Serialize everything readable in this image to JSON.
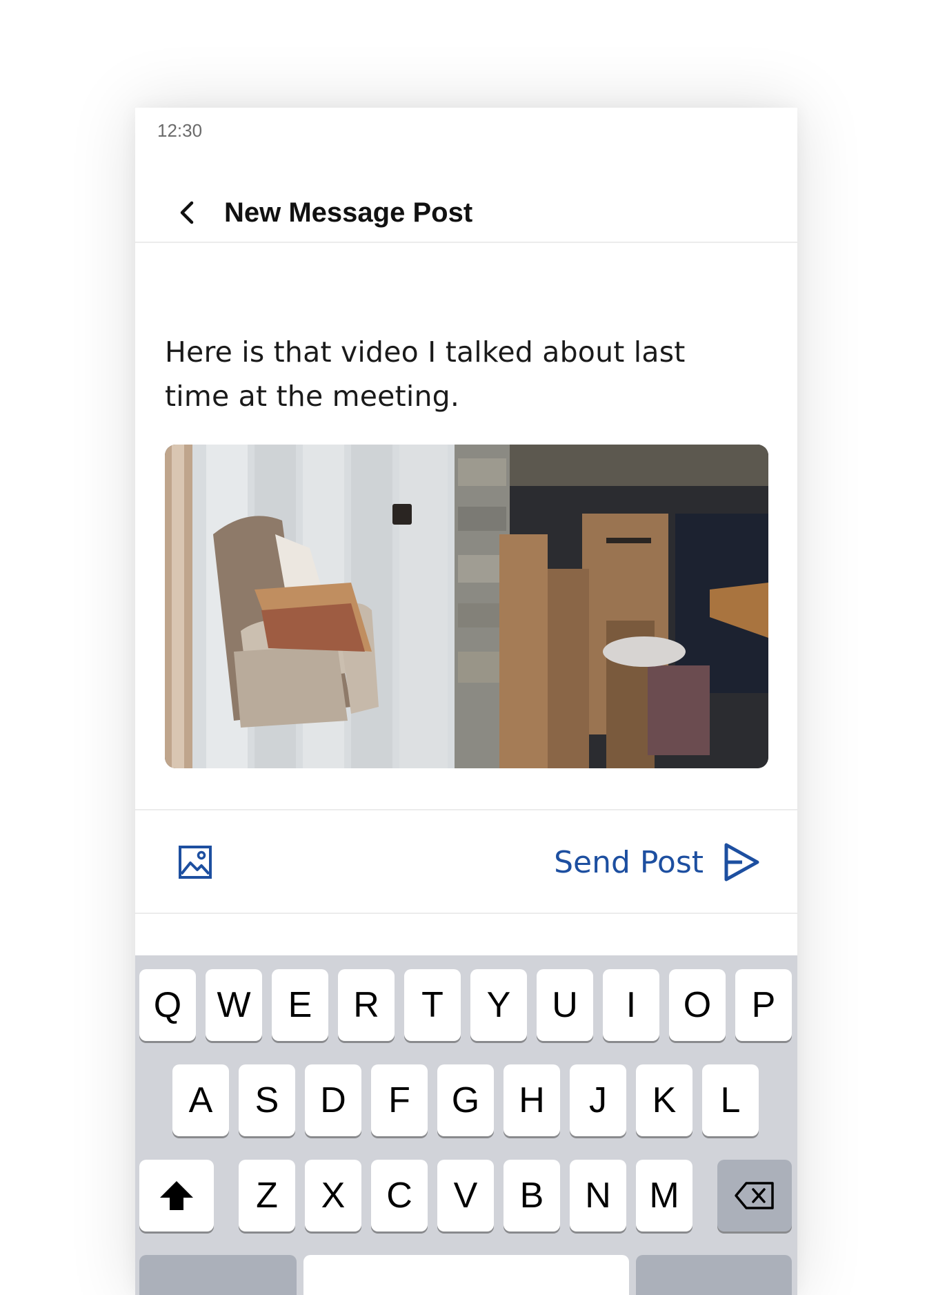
{
  "status_bar": {
    "time": "12:30"
  },
  "header": {
    "title": "New Message Post"
  },
  "message": {
    "text": "Here is that video I talked about last time at the meeting."
  },
  "actions": {
    "send_label": "Send Post"
  },
  "keyboard": {
    "rows": [
      [
        "Q",
        "W",
        "E",
        "R",
        "T",
        "Y",
        "U",
        "I",
        "O",
        "P"
      ],
      [
        "A",
        "S",
        "D",
        "F",
        "G",
        "H",
        "J",
        "K",
        "L"
      ],
      [
        "Z",
        "X",
        "C",
        "V",
        "B",
        "N",
        "M"
      ]
    ]
  },
  "colors": {
    "accent": "#1d4fa0",
    "keyboard_bg": "#d1d3d9",
    "special_key": "#abb0ba"
  },
  "icons": {
    "back": "chevron-left-icon",
    "attach_image": "image-icon",
    "send": "send-icon",
    "shift": "shift-icon",
    "backspace": "backspace-icon"
  }
}
